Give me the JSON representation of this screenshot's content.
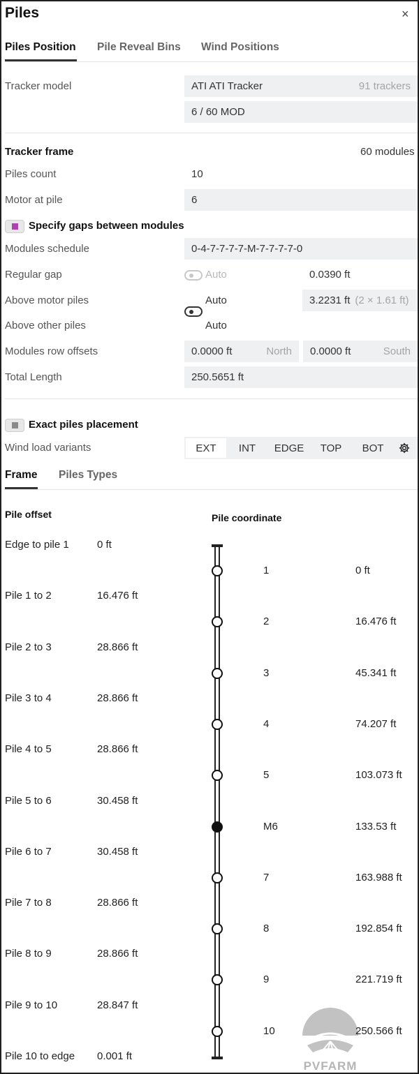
{
  "header": {
    "title": "Piles",
    "close_glyph": "×"
  },
  "tabs": [
    {
      "label": "Piles Position",
      "active": true
    },
    {
      "label": "Pile Reveal Bins",
      "active": false
    },
    {
      "label": "Wind Positions",
      "active": false
    }
  ],
  "tracker": {
    "model_label": "Tracker model",
    "model_value": "ATI ATI Tracker",
    "model_count": "91 trackers",
    "module_config": "6 / 60 MOD"
  },
  "frame": {
    "heading": "Tracker frame",
    "modules": "60 modules",
    "piles_count_label": "Piles count",
    "piles_count_value": "10",
    "motor_label": "Motor at pile",
    "motor_value": "6"
  },
  "gaps": {
    "checkbox_label": "Specify gaps between modules",
    "schedule_label": "Modules schedule",
    "schedule_value": "0-4-7-7-7-7-M-7-7-7-7-0",
    "regular_gap_label": "Regular gap",
    "regular_gap_toggle": "Auto",
    "regular_gap_value": "0.0390 ft",
    "above_motor_label": "Above motor piles",
    "above_motor_toggle": "Auto",
    "above_motor_value": "3.2231 ft",
    "above_motor_hint": "(2 × 1.61 ft)",
    "above_other_label": "Above other piles",
    "above_other_toggle": "Auto",
    "row_offsets_label": "Modules row offsets",
    "north_value": "0.0000 ft",
    "north_label": "North",
    "south_value": "0.0000 ft",
    "south_label": "South",
    "total_length_label": "Total Length",
    "total_length_value": "250.5651 ft"
  },
  "placement": {
    "exact_label": "Exact piles placement",
    "wind_label": "Wind load variants",
    "wind_variants": [
      "EXT",
      "INT",
      "EDGE",
      "TOP",
      "BOT"
    ],
    "wind_active": "EXT",
    "settings_icon": "gear-icon"
  },
  "subtabs": [
    {
      "label": "Frame",
      "active": true
    },
    {
      "label": "Piles Types",
      "active": false
    }
  ],
  "pile_offset": {
    "heading": "Pile offset",
    "rows": [
      {
        "label": "Edge to pile 1",
        "value": "0 ft"
      },
      {
        "label": "Pile 1 to 2",
        "value": "16.476 ft"
      },
      {
        "label": "Pile 2 to 3",
        "value": "28.866 ft"
      },
      {
        "label": "Pile 3 to 4",
        "value": "28.866 ft"
      },
      {
        "label": "Pile 4 to 5",
        "value": "28.866 ft"
      },
      {
        "label": "Pile 5 to 6",
        "value": "30.458 ft"
      },
      {
        "label": "Pile 6 to 7",
        "value": "30.458 ft"
      },
      {
        "label": "Pile 7 to 8",
        "value": "28.866 ft"
      },
      {
        "label": "Pile 8 to 9",
        "value": "28.866 ft"
      },
      {
        "label": "Pile 9 to 10",
        "value": "28.847 ft"
      },
      {
        "label": "Pile 10 to edge",
        "value": "0.001 ft"
      }
    ]
  },
  "pile_coordinate": {
    "heading": "Pile coordinate",
    "rows": [
      {
        "num": "1",
        "value": "0 ft",
        "motor": false
      },
      {
        "num": "2",
        "value": "16.476 ft",
        "motor": false
      },
      {
        "num": "3",
        "value": "45.341 ft",
        "motor": false
      },
      {
        "num": "4",
        "value": "74.207 ft",
        "motor": false
      },
      {
        "num": "5",
        "value": "103.073 ft",
        "motor": false
      },
      {
        "num": "M6",
        "value": "133.53 ft",
        "motor": true
      },
      {
        "num": "7",
        "value": "163.988 ft",
        "motor": false
      },
      {
        "num": "8",
        "value": "192.854 ft",
        "motor": false
      },
      {
        "num": "9",
        "value": "221.719 ft",
        "motor": false
      },
      {
        "num": "10",
        "value": "250.566 ft",
        "motor": false
      }
    ]
  },
  "watermark": {
    "text": "PVFARM"
  }
}
